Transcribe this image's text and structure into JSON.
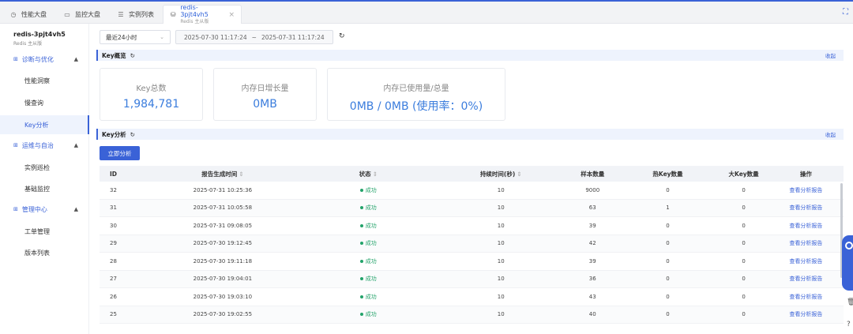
{
  "tabs": [
    {
      "label": "性能大盘",
      "icon": "clock-icon"
    },
    {
      "label": "监控大盘",
      "icon": "monitor-icon"
    },
    {
      "label": "实例列表",
      "icon": "list-icon"
    },
    {
      "label": "redis-3pjt4vh5",
      "sub": "Redis 主从版",
      "icon": "database-icon",
      "active": true
    }
  ],
  "sidebar": {
    "instance_name": "redis-3pjt4vh5",
    "instance_type": "Redis 主从版",
    "groups": [
      {
        "label": "诊断与优化",
        "items": [
          "性能洞察",
          "慢查询",
          "Key分析"
        ]
      },
      {
        "label": "运维与自治",
        "items": [
          "实例巡检",
          "基础监控"
        ]
      },
      {
        "label": "管理中心",
        "items": [
          "工单管理",
          "版本列表"
        ]
      }
    ],
    "active_item": "Key分析"
  },
  "filter": {
    "range": "最近24小时",
    "start": "2025-07-30 11:17:24",
    "sep": "~",
    "end": "2025-07-31 11:17:24"
  },
  "overview": {
    "title": "Key概览",
    "collapse": "收起",
    "cards": [
      {
        "label": "Key总数",
        "value": "1,984,781"
      },
      {
        "label": "内存日增长量",
        "value": "0MB"
      },
      {
        "label": "内存已使用量/总量",
        "value": "0MB / 0MB (使用率：0%)"
      }
    ]
  },
  "analysis": {
    "title": "Key分析",
    "collapse": "收起",
    "button": "立即分析",
    "headers": {
      "id": "ID",
      "time": "报告生成时间",
      "status": "状态",
      "duration": "持续时间(秒)",
      "sample": "样本数量",
      "hot": "热Key数量",
      "big": "大Key数量",
      "op": "操作"
    },
    "rows": [
      {
        "id": "32",
        "time": "2025-07-31 10:25:36",
        "status": "成功",
        "duration": "10",
        "sample": "9000",
        "hot": "0",
        "big": "0",
        "op": "查看分析报告"
      },
      {
        "id": "31",
        "time": "2025-07-31 10:05:58",
        "status": "成功",
        "duration": "10",
        "sample": "63",
        "hot": "1",
        "big": "0",
        "op": "查看分析报告"
      },
      {
        "id": "30",
        "time": "2025-07-31 09:08:05",
        "status": "成功",
        "duration": "10",
        "sample": "39",
        "hot": "0",
        "big": "0",
        "op": "查看分析报告"
      },
      {
        "id": "29",
        "time": "2025-07-30 19:12:45",
        "status": "成功",
        "duration": "10",
        "sample": "42",
        "hot": "0",
        "big": "0",
        "op": "查看分析报告"
      },
      {
        "id": "28",
        "time": "2025-07-30 19:11:18",
        "status": "成功",
        "duration": "10",
        "sample": "39",
        "hot": "0",
        "big": "0",
        "op": "查看分析报告"
      },
      {
        "id": "27",
        "time": "2025-07-30 19:04:01",
        "status": "成功",
        "duration": "10",
        "sample": "36",
        "hot": "0",
        "big": "0",
        "op": "查看分析报告"
      },
      {
        "id": "26",
        "time": "2025-07-30 19:03:10",
        "status": "成功",
        "duration": "10",
        "sample": "43",
        "hot": "0",
        "big": "0",
        "op": "查看分析报告"
      },
      {
        "id": "25",
        "time": "2025-07-30 19:02:55",
        "status": "成功",
        "duration": "10",
        "sample": "40",
        "hot": "0",
        "big": "0",
        "op": "查看分析报告"
      }
    ]
  },
  "colors": {
    "accent": "#3a62d7",
    "success": "#23a36a",
    "value": "#3b7ddd"
  }
}
